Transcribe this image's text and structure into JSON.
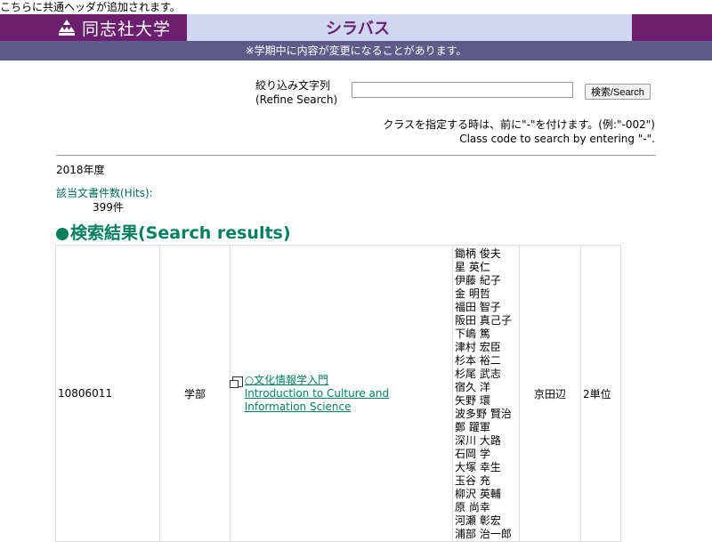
{
  "top_note": "こちらに共通ヘッダが追加されます。",
  "header": {
    "university": "同志社大学",
    "title": "シラバス",
    "logo_icon": "doshisha-emblem-icon",
    "brand_color": "#6b1f6e"
  },
  "notice": "※学期中に内容が変更になることがあります。",
  "search": {
    "label_ja": "絞り込み文字列",
    "label_en": "(Refine Search)",
    "input_value": "",
    "button_label": "検索/Search"
  },
  "class_note": {
    "ja": "クラスを指定する時は、前に\"-\"を付けます。(例:\"-002\")",
    "en": "Class code to search by entering \"-\"."
  },
  "year": "2018年度",
  "hits": {
    "label": "該当文書件数(Hits):",
    "value": "399件"
  },
  "results_title": "検索結果(Search results)",
  "results": [
    {
      "code": "10806011",
      "faculty": "学部",
      "course_ja": "○文化情報学入門",
      "course_en": "Introduction to Culture and Information Science",
      "teachers": [
        "鋤柄 俊夫",
        "星 英仁",
        "伊藤 紀子",
        "金 明哲",
        "福田 智子",
        "阪田 真己子",
        "下嶋 篤",
        "津村 宏臣",
        "杉本 裕二",
        "杉尾 武志",
        "宿久 洋",
        "矢野 環",
        "波多野 賢治",
        "鄭 躍軍",
        "深川 大路",
        "石岡 学",
        "大塚 幸生",
        "玉谷 充",
        "柳沢 英輔",
        "原 尚幸",
        "河瀬 彰宏",
        "浦部 治一郎"
      ],
      "campus": "京田辺",
      "credits": "2単位"
    }
  ]
}
